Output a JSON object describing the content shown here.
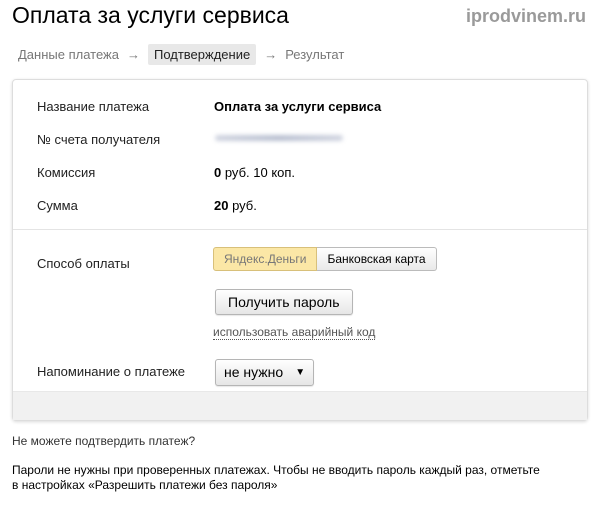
{
  "header": {
    "title": "Оплата за услуги сервиса",
    "watermark": "iprodvinem.ru"
  },
  "steps": [
    {
      "label": "Данные платежа"
    },
    {
      "label": "Подтверждение"
    },
    {
      "label": "Результат"
    }
  ],
  "arrow": "→",
  "details": {
    "name_label": "Название платежа",
    "name_value": "Оплата за услуги сервиса",
    "account_label": "№ счета получателя",
    "fee_label": "Комиссия",
    "fee_num": "0",
    "fee_rest": " руб. 10 коп.",
    "sum_label": "Сумма",
    "sum_num": "20",
    "sum_rest": " руб."
  },
  "payment": {
    "method_label": "Способ оплаты",
    "methods": [
      "Яндекс.Деньги",
      "Банковская карта"
    ],
    "get_password": "Получить пароль",
    "emergency_link": "использовать аварийный код",
    "reminder_label": "Напоминание о платеже",
    "reminder_value": "не нужно"
  },
  "footer": {
    "cant_confirm": "Не можете подтвердить платеж?",
    "note1": "Пароли не нужны при проверенных платежах. Чтобы не вводить пароль каждый раз, отметьте",
    "note2": "в настройках «Разрешить платежи без пароля»"
  }
}
